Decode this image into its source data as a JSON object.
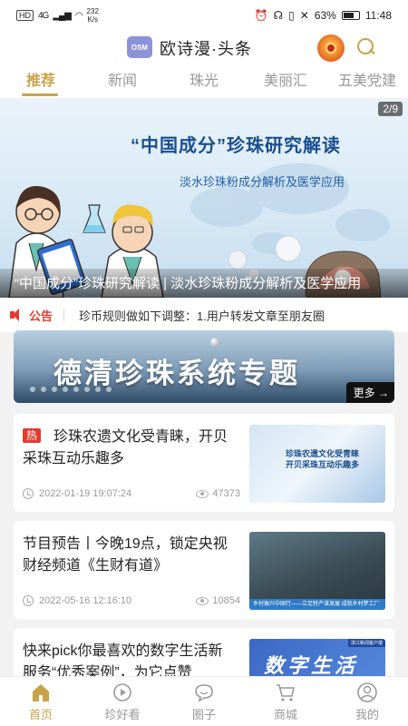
{
  "status_bar": {
    "sim_label": "HD",
    "network": "4G",
    "speed_value": "232",
    "speed_unit": "K/s",
    "battery": "63%",
    "time": "11:48"
  },
  "header": {
    "logo_text": "OSM",
    "title": "欧诗漫·头条"
  },
  "tabs": [
    {
      "label": "推荐",
      "active": true
    },
    {
      "label": "新闻",
      "active": false
    },
    {
      "label": "珠光",
      "active": false
    },
    {
      "label": "美丽汇",
      "active": false
    },
    {
      "label": "五美党建",
      "active": false
    }
  ],
  "banner": {
    "counter": "2/9",
    "headline": "“中国成分”珍珠研究解读",
    "subtitle": "淡水珍珠粉成分解析及医学应用",
    "caption": "“中国成分”珍珠研究解读 | 淡水珍珠粉成分解析及医学应用"
  },
  "notice": {
    "label": "公告",
    "text": "珍币规则做如下调整：1.用户转发文章至朋友圈"
  },
  "topic": {
    "title": "德清珍珠系统专题",
    "more_label": "更多"
  },
  "articles": [
    {
      "tag": "热",
      "title": "珍珠农遗文化受青睐，开贝采珠互动乐趣多",
      "date": "2022-01-19 19:07:24",
      "views": "47373",
      "thumb_text_1": "珍珠农遗文化受青睐",
      "thumb_text_2": "开贝采珠互动乐趣多"
    },
    {
      "tag": "",
      "title": "节目预告丨今晚19点，锁定央视财经频道《生财有道》",
      "date": "2022-05-16 12:16:10",
      "views": "10854",
      "thumb_bar": "乡村振兴中国行——立足特产谋发展 成就乡村梦工厂"
    },
    {
      "tag": "",
      "title": "快来pick你最喜欢的数字生活新服务“优秀案例”，为它点赞",
      "date": "",
      "views": "",
      "thumb_text": "数字生活",
      "thumb_corner": "浙江新闻客户端"
    }
  ],
  "bottom_nav": [
    {
      "label": "首页",
      "icon": "home-icon",
      "active": true
    },
    {
      "label": "珍好看",
      "icon": "play-icon",
      "active": false
    },
    {
      "label": "圈子",
      "icon": "chat-icon",
      "active": false
    },
    {
      "label": "商城",
      "icon": "cart-icon",
      "active": false
    },
    {
      "label": "我的",
      "icon": "user-icon",
      "active": false
    }
  ],
  "colors": {
    "accent": "#c9a24a",
    "notice_red": "#e23b2e",
    "banner_blue": "#1a4f8f"
  }
}
